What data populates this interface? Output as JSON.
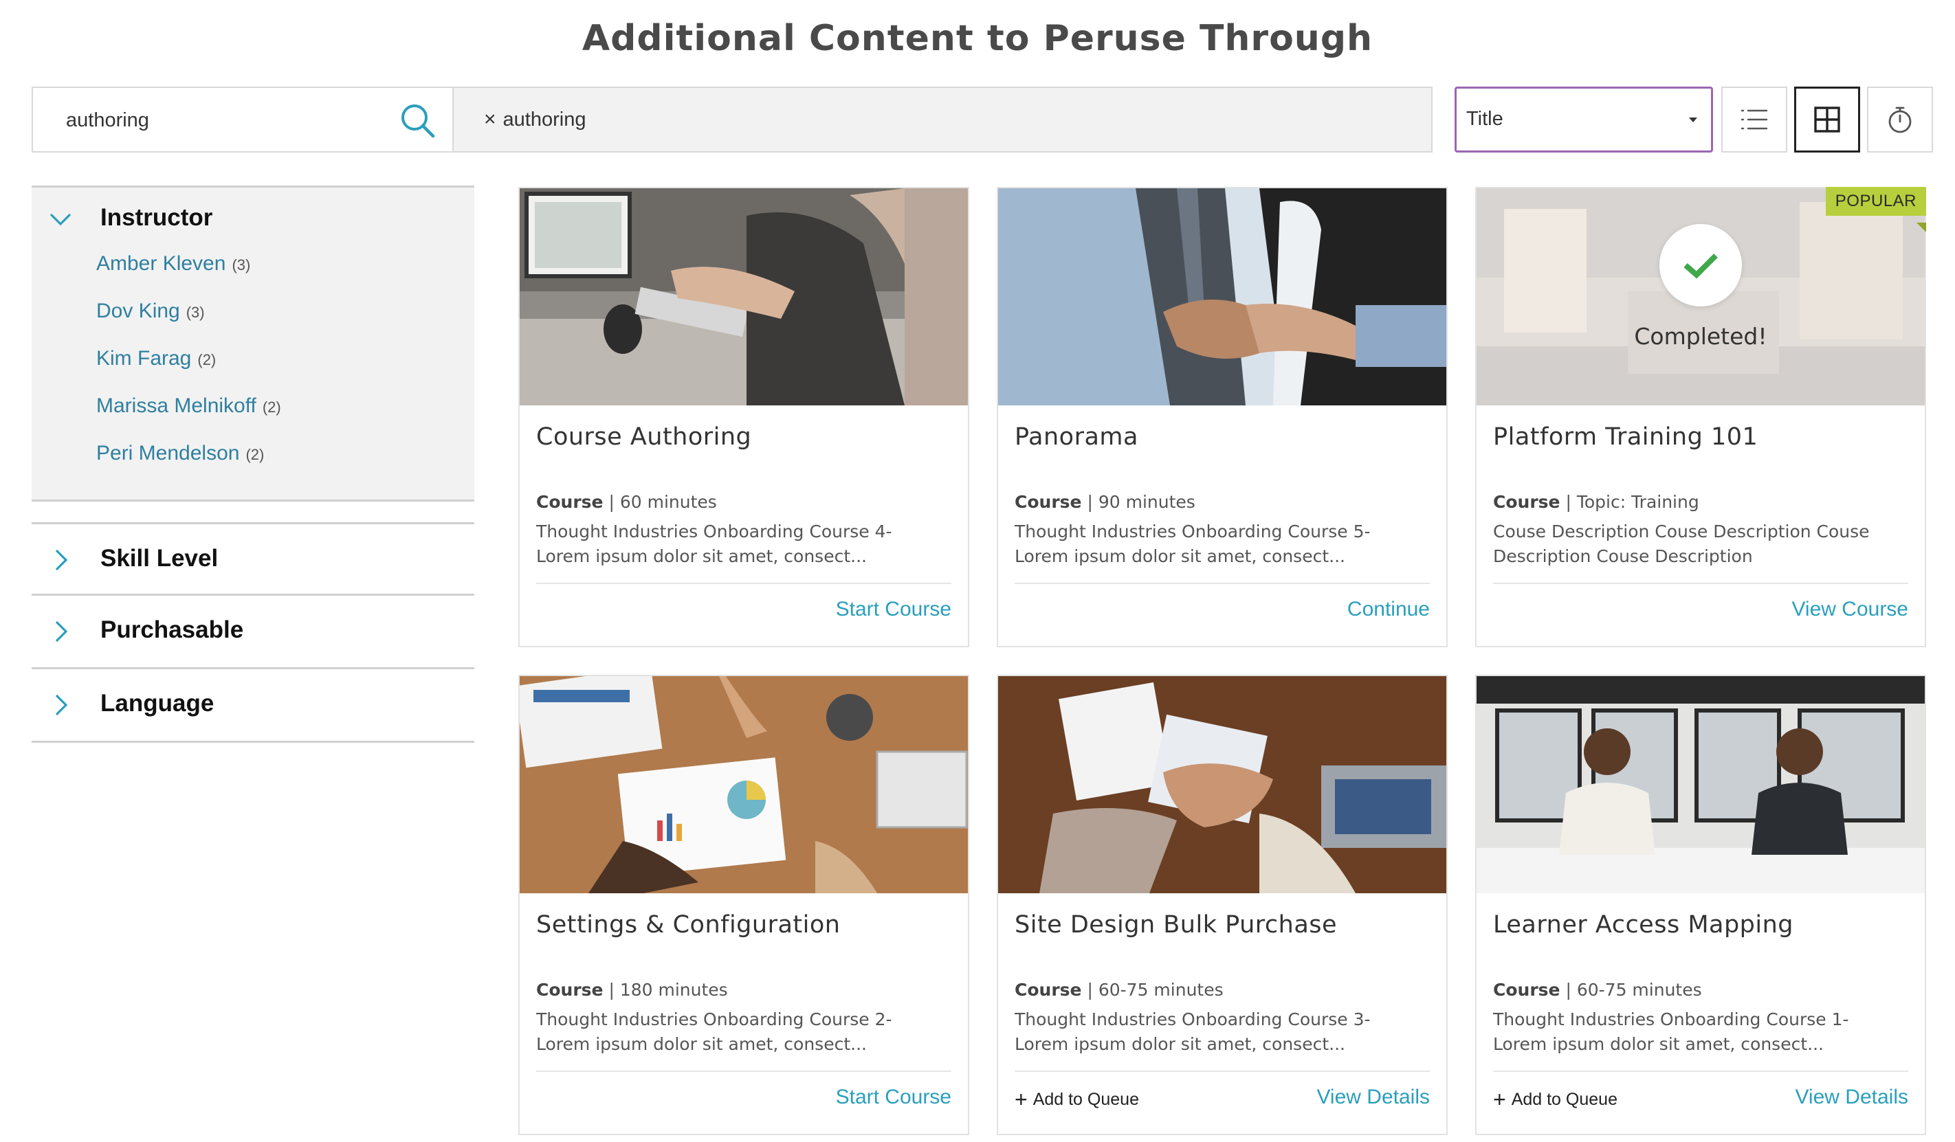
{
  "page": {
    "title": "Additional Content to Peruse Through"
  },
  "search": {
    "value": "authoring"
  },
  "filters": {
    "active_chip": "authoring",
    "remove_symbol": "×"
  },
  "sort": {
    "selected": "Title"
  },
  "view": {
    "active": "grid",
    "options": [
      "list",
      "grid",
      "timer"
    ]
  },
  "sidebar": {
    "instructor": {
      "label": "Instructor",
      "expanded": true,
      "items": [
        {
          "name": "Amber Kleven",
          "count": "(3)"
        },
        {
          "name": "Dov King",
          "count": "(3)"
        },
        {
          "name": "Kim Farag",
          "count": "(2)"
        },
        {
          "name": "Marissa Melnikoff",
          "count": "(2)"
        },
        {
          "name": "Peri Mendelson",
          "count": "(2)"
        }
      ]
    },
    "collapsed": [
      {
        "label": "Skill Level"
      },
      {
        "label": "Purchasable"
      },
      {
        "label": "Language"
      }
    ]
  },
  "cards": [
    {
      "title": "Course Authoring",
      "type": "Course",
      "meta": "60 minutes",
      "description": "Thought Industries Onboarding Course 4- Lorem ipsum dolor sit amet, consect...",
      "action": "Start Course",
      "image": "typing-at-desk"
    },
    {
      "title": "Panorama",
      "type": "Course",
      "meta": "90 minutes",
      "description": "Thought Industries Onboarding Course 5- Lorem ipsum dolor sit amet, consect...",
      "action": "Continue",
      "image": "handshake"
    },
    {
      "title": "Platform Training 101",
      "type": "Course",
      "meta": "Topic: Training",
      "description": "Couse Description Couse Description Couse Description Couse Description",
      "action": "View Course",
      "image": "office-interior",
      "badge": "POPULAR",
      "status": "Completed!"
    },
    {
      "title": "Settings & Configuration",
      "type": "Course",
      "meta": "180 minutes",
      "description": "Thought Industries Onboarding Course 2- Lorem ipsum dolor sit amet, consect...",
      "action": "Start Course",
      "image": "charts-on-table"
    },
    {
      "title": "Site Design Bulk Purchase",
      "type": "Course",
      "meta": "60-75 minutes",
      "description": "Thought Industries Onboarding Course 3- Lorem ipsum dolor sit amet, consect...",
      "action": "View Details",
      "secondary": "Add to Queue",
      "image": "hands-stacked"
    },
    {
      "title": "Learner Access Mapping",
      "type": "Course",
      "meta": "60-75 minutes",
      "description": "Thought Industries Onboarding Course 1- Lorem ipsum dolor sit amet, consect...",
      "action": "View Details",
      "secondary": "Add to Queue",
      "image": "two-women-meeting"
    }
  ],
  "colors": {
    "accent": "#2a9fbc",
    "link": "#2f7fa0",
    "select_border": "#9b66b3",
    "badge": "#b7cf3c",
    "check": "#3ea84a"
  }
}
